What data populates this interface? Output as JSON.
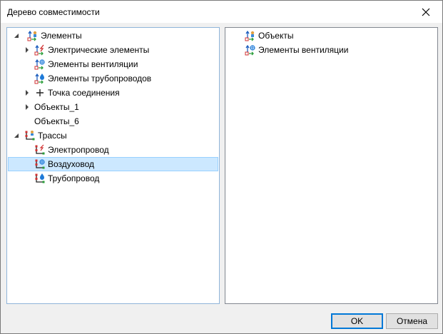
{
  "window": {
    "title": "Дерево совместимости"
  },
  "left_tree": {
    "items": [
      {
        "label": "Элементы",
        "icon": "elements-tree-icon",
        "expander": "expanded"
      },
      {
        "label": "Электрические элементы",
        "icon": "electrical-element-icon",
        "expander": "collapsed"
      },
      {
        "label": "Элементы вентиляции",
        "icon": "ventilation-element-icon",
        "expander": "none"
      },
      {
        "label": "Элементы трубопроводов",
        "icon": "pipeline-element-icon",
        "expander": "none"
      },
      {
        "label": "Точка соединения",
        "icon": "connection-point-icon",
        "expander": "collapsed"
      },
      {
        "label": "Объекты_1",
        "icon": "",
        "expander": "collapsed"
      },
      {
        "label": "Объекты_6",
        "icon": "",
        "expander": "none"
      },
      {
        "label": "Трассы",
        "icon": "routes-icon",
        "expander": "expanded"
      },
      {
        "label": "Электропровод",
        "icon": "electric-wire-icon",
        "expander": "none"
      },
      {
        "label": "Воздуховод",
        "icon": "air-duct-icon",
        "expander": "none",
        "selected": true
      },
      {
        "label": "Трубопровод",
        "icon": "pipeline-route-icon",
        "expander": "none"
      }
    ]
  },
  "right_tree": {
    "items": [
      {
        "label": "Объекты",
        "icon": "objects-icon"
      },
      {
        "label": "Элементы вентиляции",
        "icon": "ventilation-element-icon"
      }
    ]
  },
  "buttons": {
    "ok": "OK",
    "cancel": "Отмена"
  },
  "colors": {
    "selection": "#cce8ff",
    "selection_border": "#99d1ff",
    "accent": "#0078d7"
  }
}
